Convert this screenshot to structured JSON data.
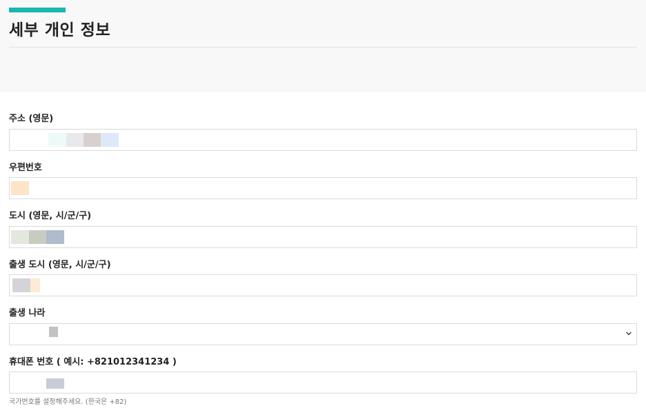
{
  "header": {
    "title": "세부 개인 정보",
    "accent_color": "#1ab6b0"
  },
  "fields": [
    {
      "label": "주소 (영문)",
      "value": "",
      "redacted": true
    },
    {
      "label": "우편번호",
      "value": "",
      "redacted": true
    },
    {
      "label": "도시 (영문, 시/군/구)",
      "value": "",
      "redacted": true
    },
    {
      "label": "출생 도시 (영문, 시/군/구)",
      "value": "",
      "redacted": true
    },
    {
      "label": "출생 나라",
      "value": "",
      "redacted": true,
      "control": "select",
      "icon": "chevron-down-icon"
    },
    {
      "label": "휴대폰 번호 ( 예시: +821012341234 )",
      "value": "",
      "redacted": true,
      "helper": "국가번호를 설정해주세요. (한국은 +82)"
    }
  ]
}
